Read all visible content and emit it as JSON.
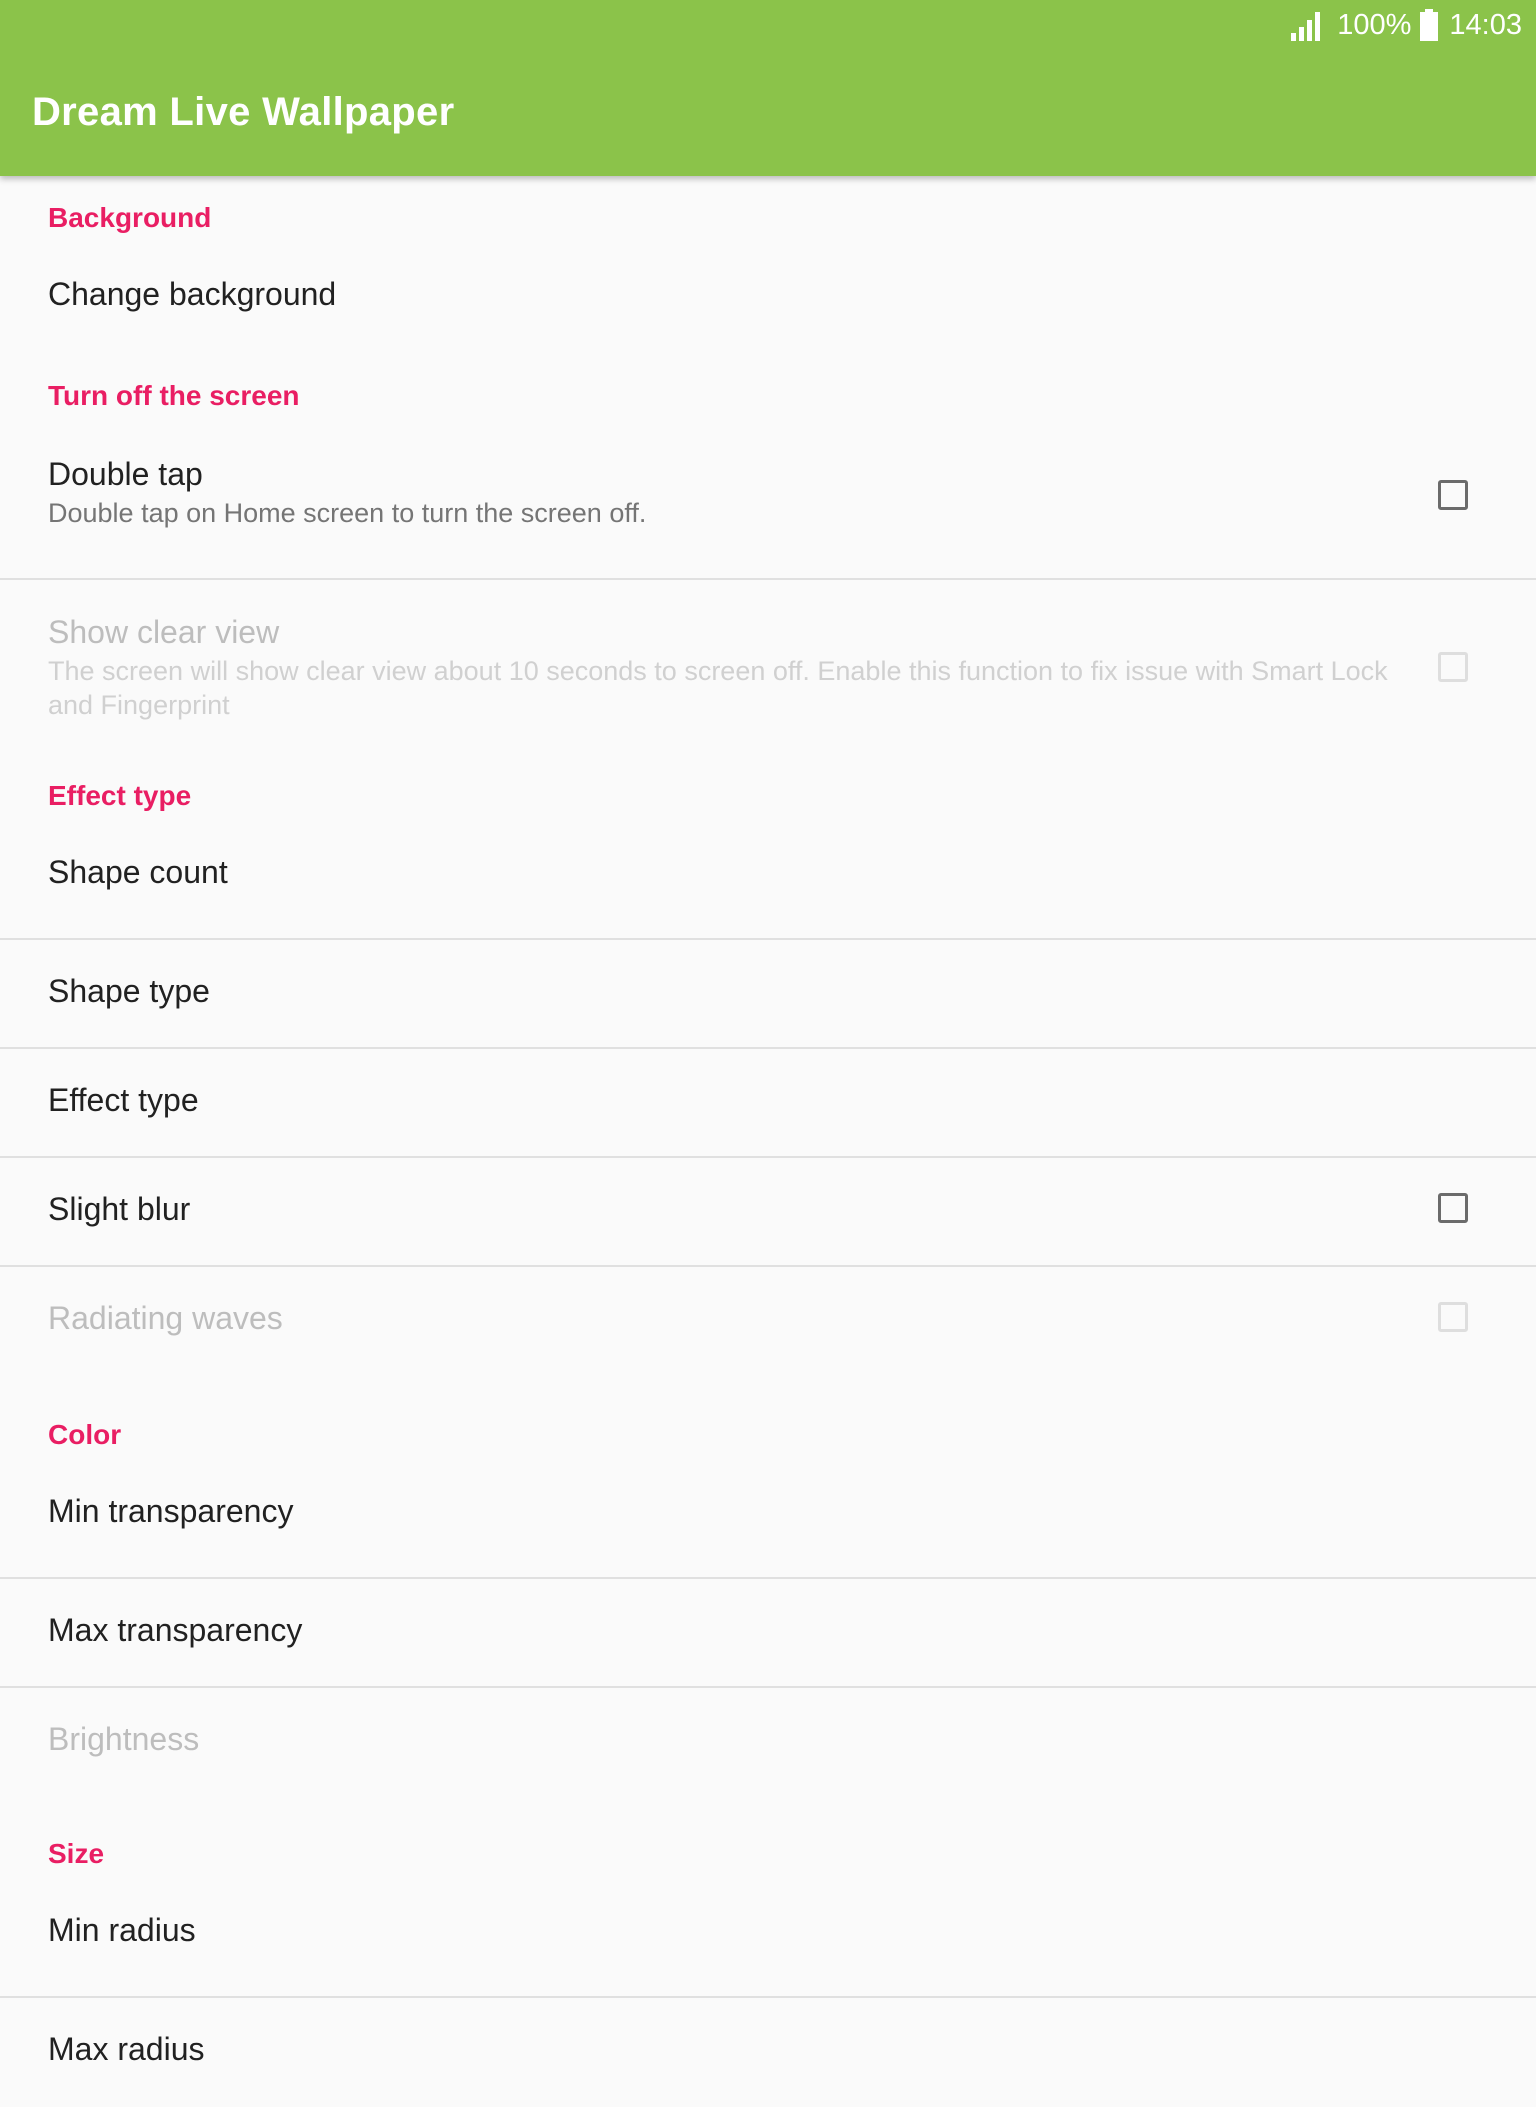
{
  "status_bar": {
    "signal_icon": "signal-bars-icon",
    "battery_percent": "100%",
    "battery_icon": "battery-icon",
    "time": "14:03"
  },
  "app_bar": {
    "title": "Dream Live Wallpaper",
    "color": "#8bc34a"
  },
  "colors": {
    "accent": "#e91e63",
    "primary_text": "#212121",
    "secondary_text": "#757575",
    "disabled_text": "#bdbdbd"
  },
  "categories": {
    "background": "Background",
    "screen": "Turn off the screen",
    "effect": "Effect type",
    "color": "Color",
    "size": "Size"
  },
  "prefs": {
    "change_background": {
      "title": "Change background"
    },
    "double_tap": {
      "title": "Double tap",
      "summary": "Double tap on Home screen to turn the screen off.",
      "checked": false
    },
    "show_clear_view": {
      "title": "Show clear view",
      "summary": "The screen will show clear view about 10 seconds to screen off. Enable this function to fix issue with Smart Lock and Fingerprint",
      "checked": false,
      "enabled": false
    },
    "shape_count": {
      "title": "Shape count"
    },
    "shape_type": {
      "title": "Shape type"
    },
    "effect_type": {
      "title": "Effect type"
    },
    "slight_blur": {
      "title": "Slight blur",
      "checked": false
    },
    "radiating_waves": {
      "title": "Radiating waves",
      "checked": false,
      "enabled": false
    },
    "min_transparency": {
      "title": "Min transparency"
    },
    "max_transparency": {
      "title": "Max transparency"
    },
    "brightness": {
      "title": "Brightness",
      "enabled": false
    },
    "min_radius": {
      "title": "Min radius"
    },
    "max_radius": {
      "title": "Max radius"
    }
  }
}
